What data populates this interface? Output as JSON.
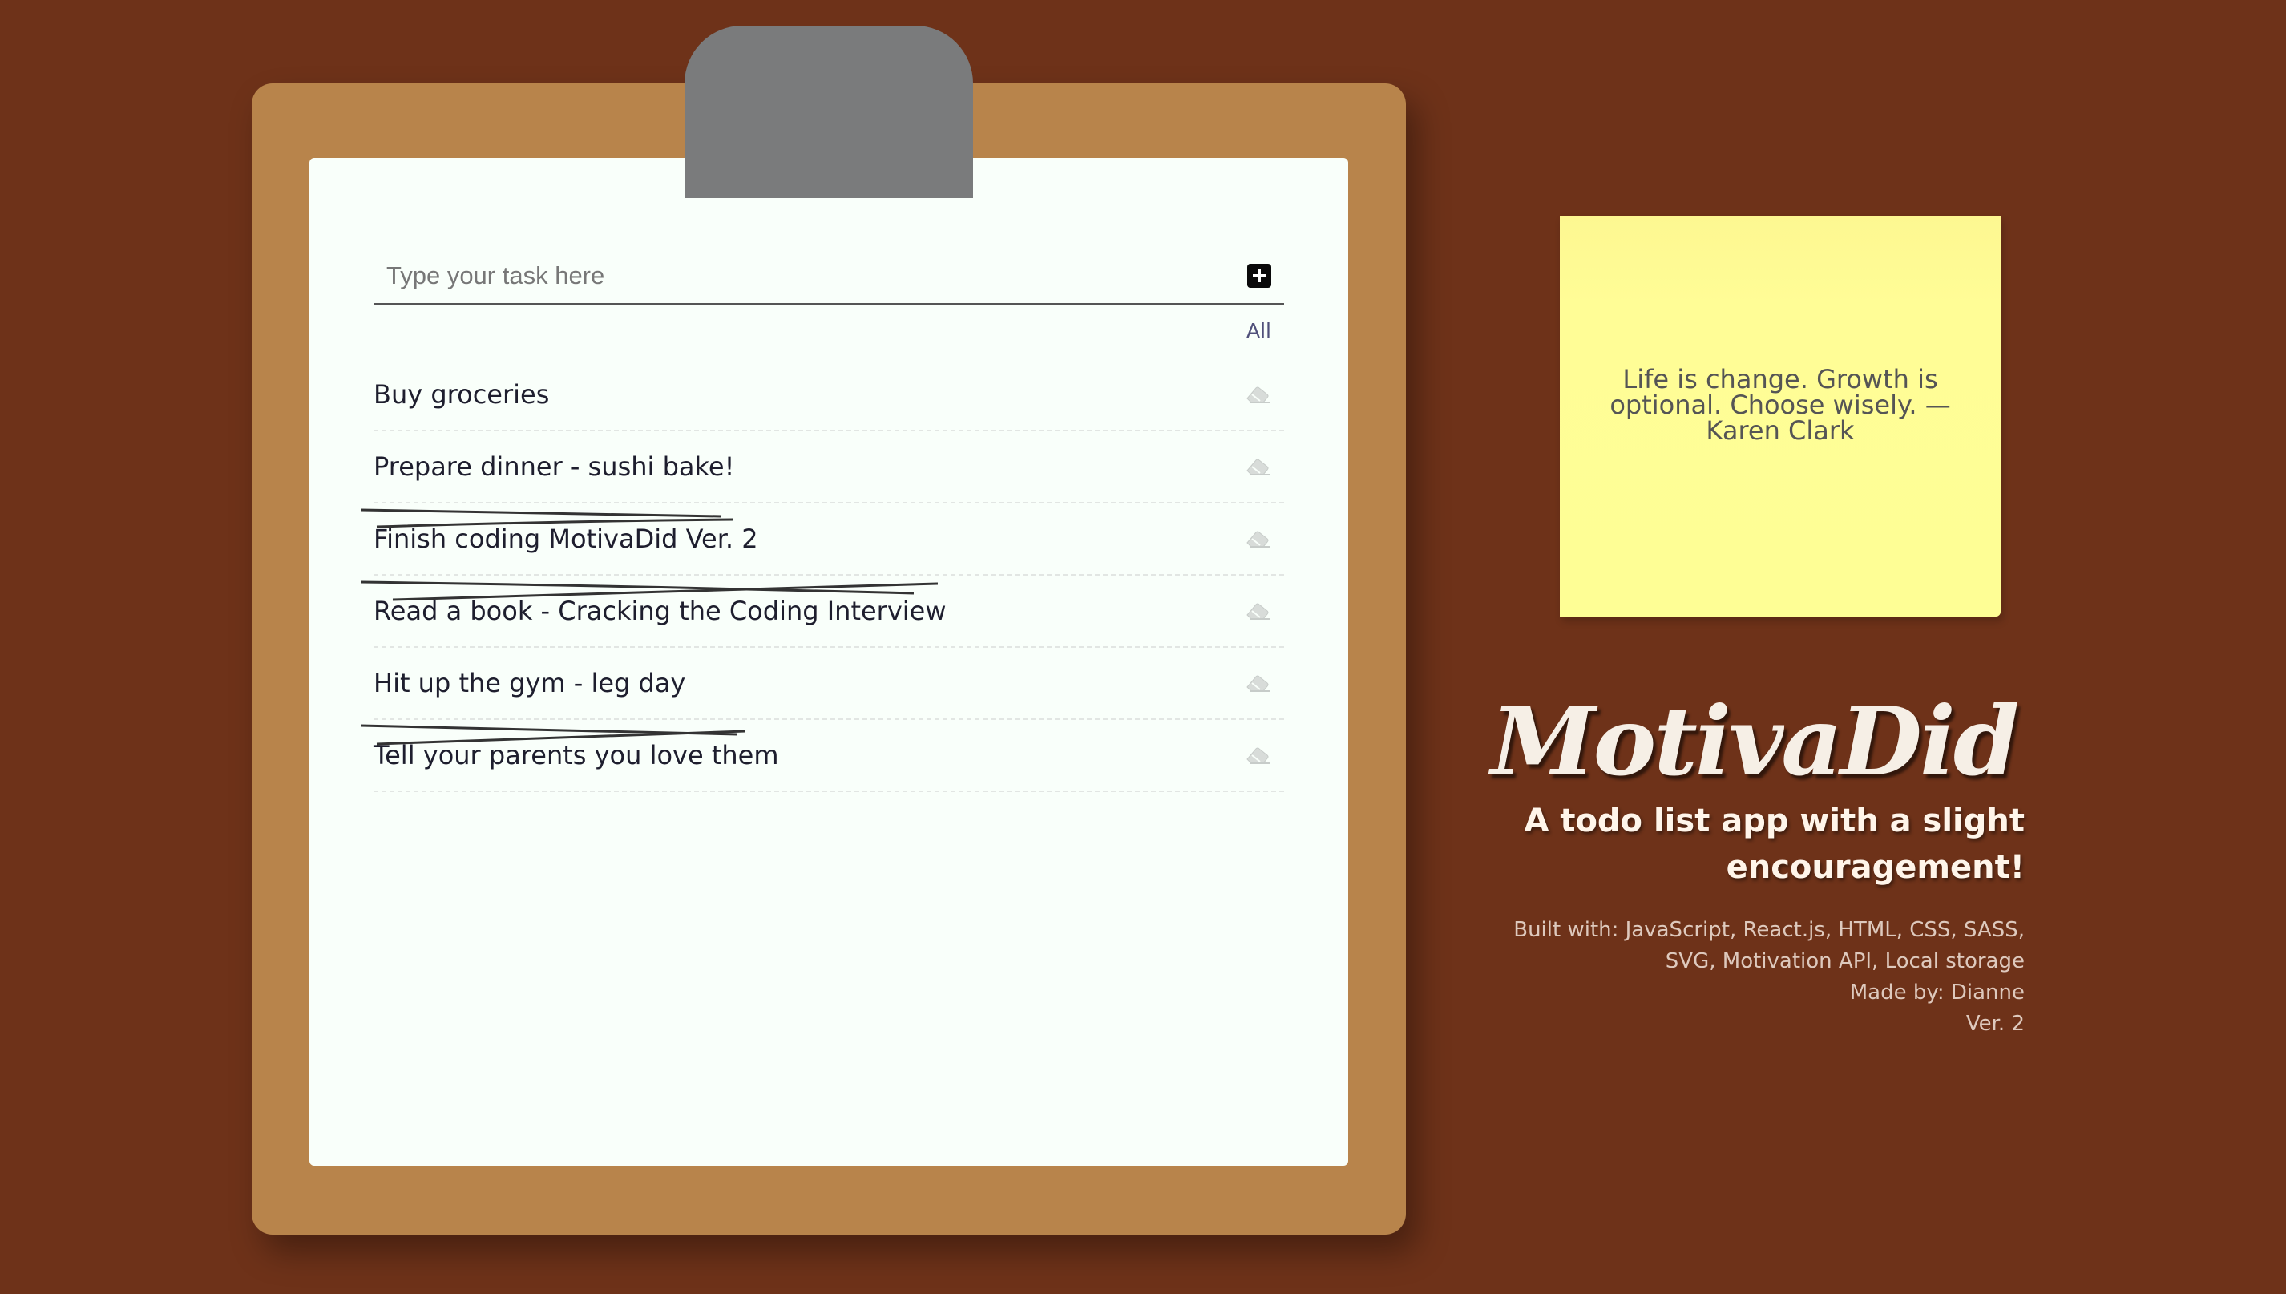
{
  "input": {
    "placeholder": "Type your task here"
  },
  "filter_label": "All",
  "tasks": [
    {
      "label": "Buy groceries",
      "done": false
    },
    {
      "label": "Prepare dinner - sushi bake!",
      "done": false
    },
    {
      "label": "Finish coding MotivaDid Ver. 2",
      "done": true
    },
    {
      "label": "Read a book - Cracking the Coding Interview",
      "done": true
    },
    {
      "label": "Hit up the gym - leg day",
      "done": false
    },
    {
      "label": "Tell your parents you love them",
      "done": true
    }
  ],
  "quote": "Life is change. Growth is optional. Choose wisely. — Karen Clark",
  "app": {
    "title": "MotivaDid",
    "tagline_line1": "A todo list app with a slight",
    "tagline_line2": "encouragement!",
    "built_with_line1": "Built with: JavaScript, React.js, HTML, CSS, SASS,",
    "built_with_line2": "SVG, Motivation API, Local storage",
    "made_by": "Made by: Dianne",
    "version": "Ver. 2"
  },
  "colors": {
    "background": "#6e3219",
    "clipboard": "#b8844b",
    "paper": "#f9fffa",
    "clip": "#7a7b7c",
    "sticky_note": "#fefe95"
  },
  "icons": {
    "add": "plus-square-icon",
    "delete": "eraser-icon"
  }
}
